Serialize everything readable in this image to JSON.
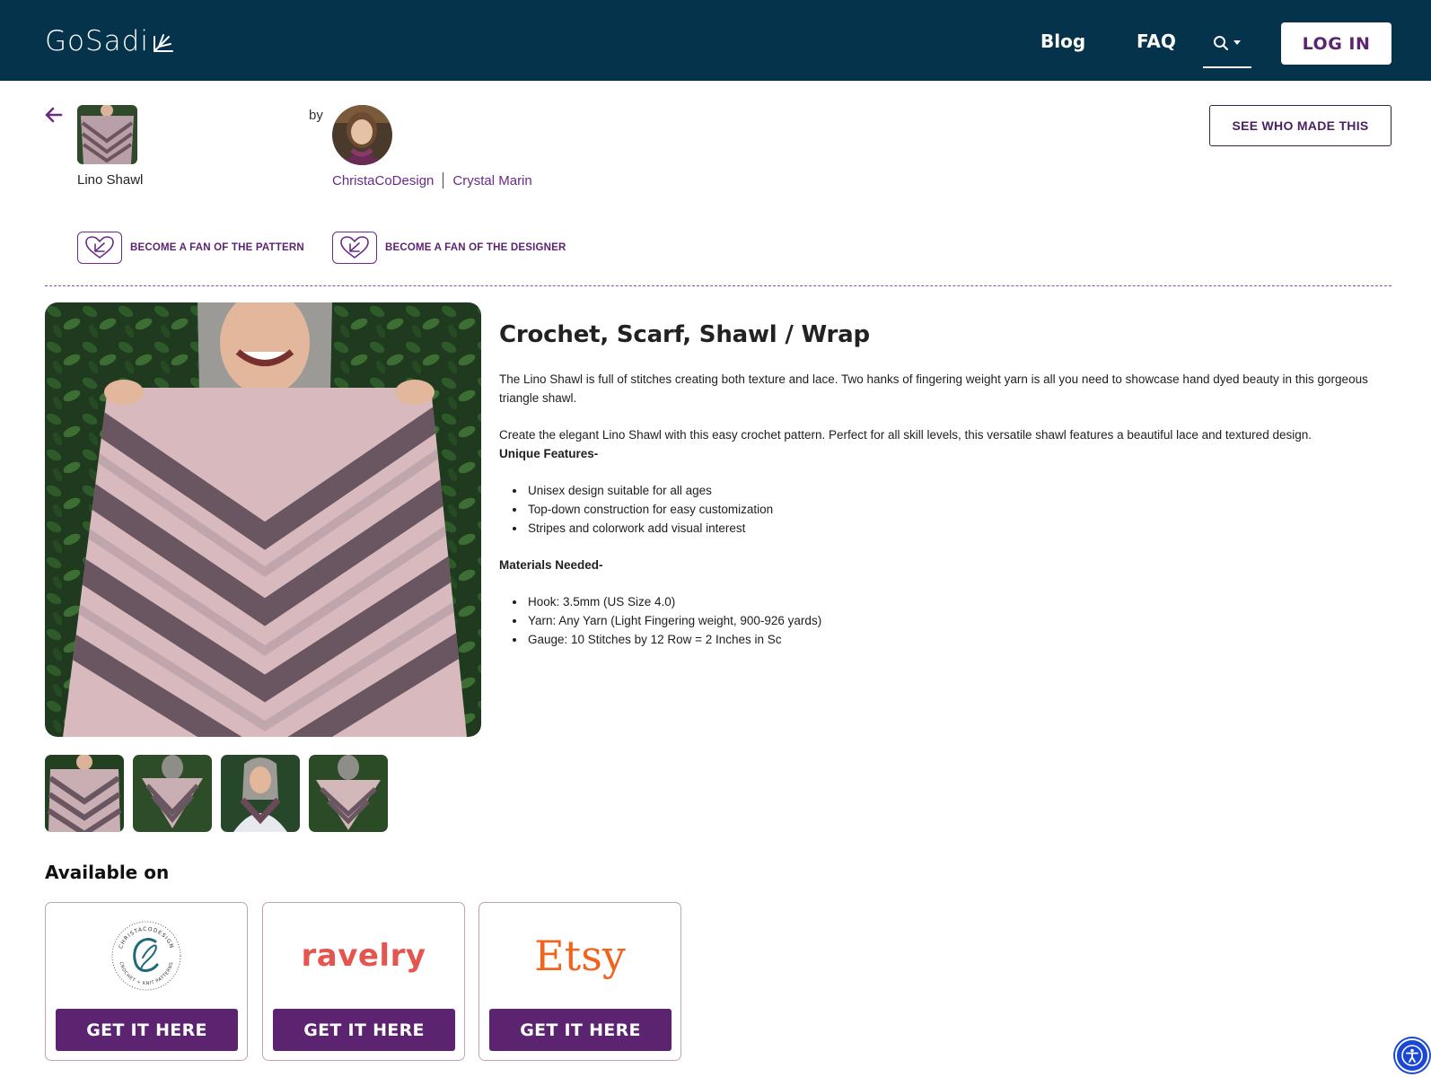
{
  "header": {
    "logo_text": "GoSadi",
    "nav": {
      "blog": "Blog",
      "faq": "FAQ"
    },
    "login_label": "LOG IN"
  },
  "pattern": {
    "name": "Lino Shawl",
    "by_label": "by",
    "designer_shop": "ChristaCoDesign",
    "designer_name": "Crystal Marin",
    "see_who_label": "SEE WHO MADE THIS",
    "fan_pattern_label": "BECOME A FAN OF THE PATTERN",
    "fan_designer_label": "BECOME A FAN OF THE DESIGNER"
  },
  "description": {
    "title": "Crochet, Scarf, Shawl / Wrap",
    "para1": "The Lino Shawl is full of stitches creating both texture and lace. Two hanks of fingering weight yarn is all you need to showcase hand dyed beauty in this gorgeous triangle shawl.",
    "para2": "Create the elegant Lino Shawl with this easy crochet pattern. Perfect for all skill levels, this versatile shawl features a beautiful lace and textured design.",
    "features_heading": "Unique Features-",
    "features": [
      "Unisex design suitable for all ages",
      "Top-down construction for easy customization",
      "Stripes and colorwork add visual interest"
    ],
    "materials_heading": "Materials Needed-",
    "materials": [
      "Hook: 3.5mm (US Size 4.0)",
      "Yarn: Any Yarn (Light Fingering weight, 900-926 yards)",
      "Gauge: 10 Stitches by 12 Row = 2 Inches in Sc"
    ]
  },
  "available": {
    "title": "Available on",
    "stores": [
      {
        "name": "ChristaCoDesign",
        "logo_top": "CHRISTACODESIGN",
        "logo_bottom": "CROCHET + KNIT PATTERNS",
        "button": "GET IT HERE"
      },
      {
        "name": "ravelry",
        "button": "GET IT HERE"
      },
      {
        "name": "Etsy",
        "button": "GET IT HERE"
      }
    ]
  },
  "colors": {
    "header_bg": "#05334b",
    "brand_purple": "#5c2370",
    "link_purple": "#6a2a86",
    "ravelry_red": "#e5554f",
    "etsy_orange": "#f1641e"
  },
  "icons": {
    "back": "arrow-left-icon",
    "search": "search-icon",
    "fan": "heart-logo-icon",
    "accessibility": "accessibility-icon"
  }
}
